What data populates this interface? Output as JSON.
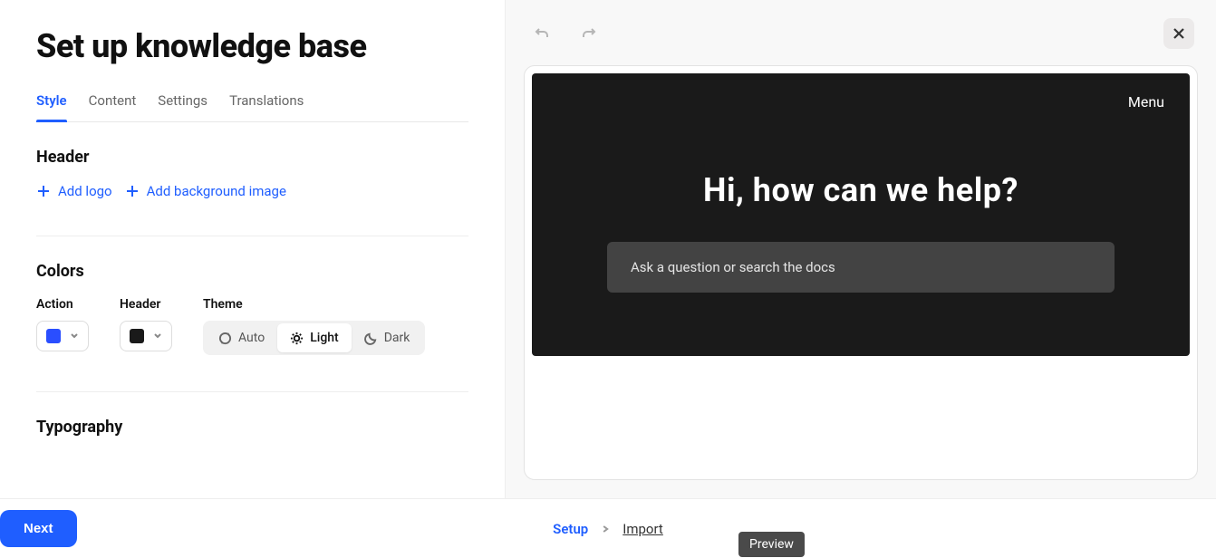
{
  "page": {
    "title": "Set up knowledge base"
  },
  "tabs": [
    {
      "label": "Style",
      "active": true
    },
    {
      "label": "Content",
      "active": false
    },
    {
      "label": "Settings",
      "active": false
    },
    {
      "label": "Translations",
      "active": false
    }
  ],
  "sections": {
    "header": {
      "title": "Header",
      "add_logo": "Add logo",
      "add_bg": "Add background image"
    },
    "colors": {
      "title": "Colors",
      "action_label": "Action",
      "action_color": "#2a4eff",
      "header_label": "Header",
      "header_color": "#1a1a1a",
      "theme_label": "Theme",
      "options": {
        "auto": "Auto",
        "light": "Light",
        "dark": "Dark"
      },
      "selected_theme": "light"
    },
    "typography": {
      "title": "Typography"
    }
  },
  "preview": {
    "menu_label": "Menu",
    "heading": "Hi, how can we help?",
    "search_placeholder": "Ask a question or search the docs"
  },
  "footer": {
    "setup": "Setup",
    "import": "Import",
    "next": "Next"
  },
  "tooltip": "Preview"
}
